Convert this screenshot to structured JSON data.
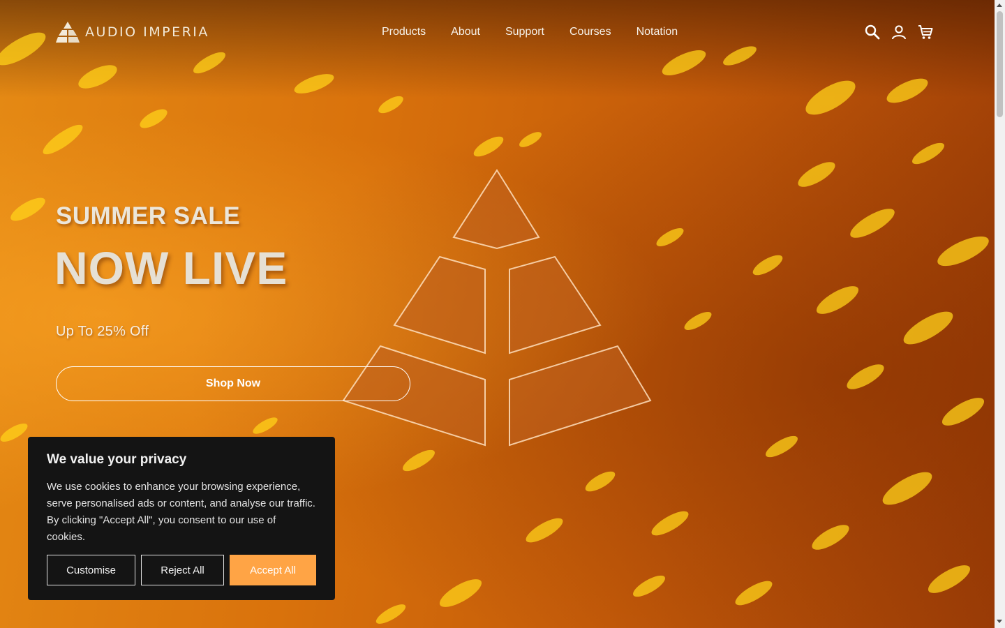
{
  "brand": {
    "name": "AUDIO IMPERIA"
  },
  "nav": {
    "items": [
      "Products",
      "About",
      "Support",
      "Courses",
      "Notation"
    ],
    "icons": [
      "search-icon",
      "account-icon",
      "cart-icon"
    ]
  },
  "hero": {
    "headline_small": "SUMMER SALE",
    "headline_big": "NOW LIVE",
    "subtitle": "Up To 25% Off",
    "cta_label": "Shop Now"
  },
  "cookie": {
    "title": "We value your privacy",
    "body": "We use cookies to enhance your browsing experience, serve personalised ads or content, and analyse our traffic. By clicking \"Accept All\", you consent to our use of cookies.",
    "customise_label": "Customise",
    "reject_label": "Reject All",
    "accept_label": "Accept All"
  },
  "colors": {
    "accent": "#ffa445",
    "hero_orange": "#d9720c",
    "cookie_bg": "#141414"
  }
}
